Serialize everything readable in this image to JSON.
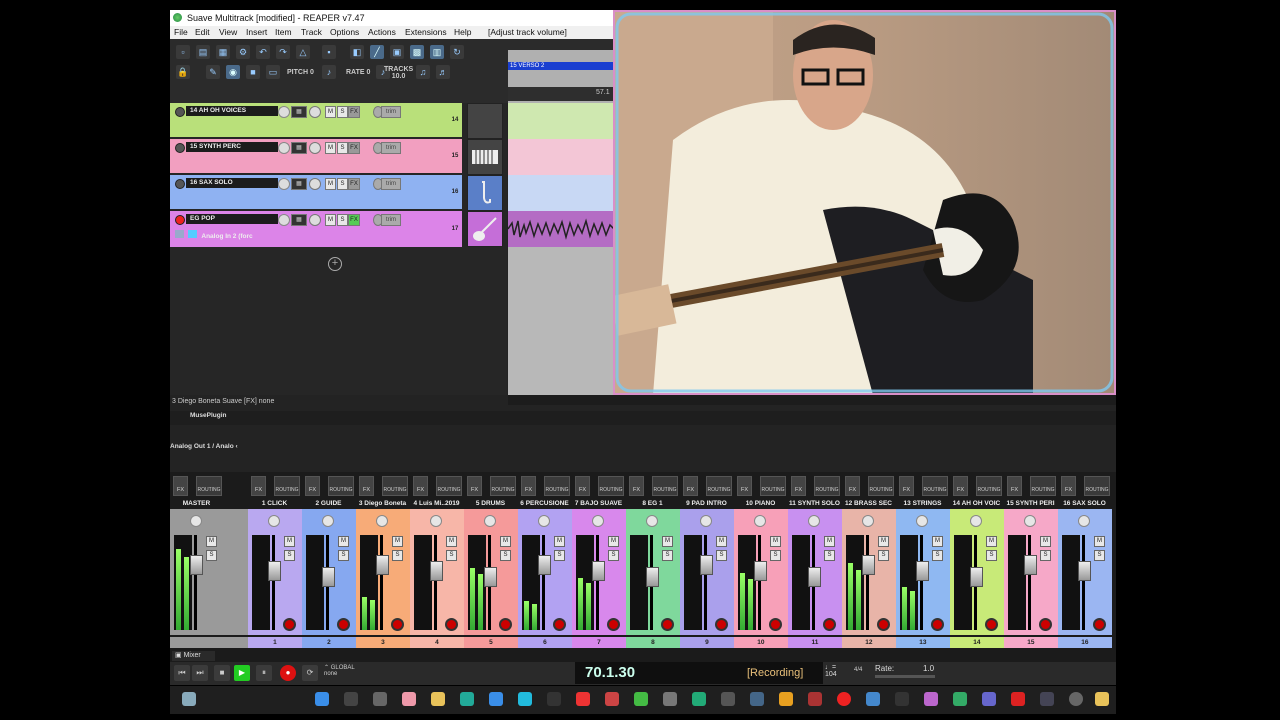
{
  "window": {
    "title": "Suave Multitrack [modified] - REAPER v7.47"
  },
  "menu": [
    "File",
    "Edit",
    "View",
    "Insert",
    "Item",
    "Track",
    "Options",
    "Actions",
    "Extensions",
    "Help",
    "[Adjust track volume]"
  ],
  "toolbar": {
    "pitch_label": "PITCH",
    "pitch_value": "0",
    "rate_label": "RATE",
    "rate_value": "0",
    "tracks_label": "TRACKS",
    "tracks_value": "10.0"
  },
  "tracks": [
    {
      "name": "14 AH OH VOICES",
      "number": "14",
      "color": "#b9e07a",
      "armed": false,
      "fx_on": false
    },
    {
      "name": "15 SYNTH PERC",
      "number": "15",
      "color": "#f29fc0",
      "armed": false,
      "fx_on": false
    },
    {
      "name": "16 SAX SOLO",
      "number": "16",
      "color": "#8fb2f2",
      "armed": false,
      "fx_on": false
    },
    {
      "name": "EG POP",
      "number": "17",
      "color": "#dc84e8",
      "armed": true,
      "fx_on": true,
      "input": "Analog In 2 (forc"
    }
  ],
  "arrange": {
    "region_label": "15 VERSO 2",
    "ruler_value": "57.1"
  },
  "status": {
    "selected_info": "3 Diego Boneta  Suave [FX] none",
    "plugin_name": "MusePlugin",
    "master_io": "Analog Out 1 / Analo"
  },
  "mixer": {
    "fx_label": "FX",
    "routing_label": "ROUTING",
    "mute_label": "M",
    "solo_label": "S",
    "strips": [
      {
        "name": "MASTER",
        "number": "",
        "color": "#9a9a9a",
        "level": 0.85
      },
      {
        "name": "1 CLICK",
        "number": "1",
        "color": "#b9a8f0",
        "level": 0.0
      },
      {
        "name": "2 GUIDE",
        "number": "2",
        "color": "#86a8f0",
        "level": 0.0
      },
      {
        "name": "3 Diego Boneta",
        "number": "3",
        "color": "#f7ab78",
        "level": 0.35
      },
      {
        "name": "4 Luis Mi..2019",
        "number": "4",
        "color": "#f7b6a8",
        "level": 0.0
      },
      {
        "name": "5 DRUMS",
        "number": "5",
        "color": "#f59a9a",
        "level": 0.65
      },
      {
        "name": "6 PERCUSIONE",
        "number": "6",
        "color": "#b2a2f2",
        "level": 0.3
      },
      {
        "name": "7 BAJO SUAVE",
        "number": "7",
        "color": "#d888ec",
        "level": 0.55
      },
      {
        "name": "8 EG 1",
        "number": "8",
        "color": "#7fd89c",
        "level": 0.0
      },
      {
        "name": "9 PAD INTRO",
        "number": "9",
        "color": "#aaa0ec",
        "level": 0.0
      },
      {
        "name": "10 PIANO",
        "number": "10",
        "color": "#f7a0b8",
        "level": 0.6
      },
      {
        "name": "11 SYNTH SOLO",
        "number": "11",
        "color": "#c890f0",
        "level": 0.0
      },
      {
        "name": "12 BRASS SEC",
        "number": "12",
        "color": "#e8b4a8",
        "level": 0.7
      },
      {
        "name": "13 STRINGS",
        "number": "13",
        "color": "#8fb8f2",
        "level": 0.45
      },
      {
        "name": "14 AH OH VOIC",
        "number": "14",
        "color": "#c8ea78",
        "level": 0.0
      },
      {
        "name": "15 SYNTH PERI",
        "number": "15",
        "color": "#f6a8c8",
        "level": 0.0
      },
      {
        "name": "16 SAX SOLO",
        "number": "16",
        "color": "#9bb6f2",
        "level": 0.0
      }
    ],
    "tab_label": "Mixer"
  },
  "transport": {
    "time": "70.1.30",
    "status": "[Recording]",
    "bpm": "104",
    "time_signature": "4/4",
    "rate_label": "Rate:",
    "rate_value": "1.0",
    "global_label": "GLOBAL",
    "global_value": "none"
  },
  "colors": {
    "accent_blue": "#1a3fd0",
    "record_red": "#dd1111",
    "play_green": "#22cc22"
  }
}
